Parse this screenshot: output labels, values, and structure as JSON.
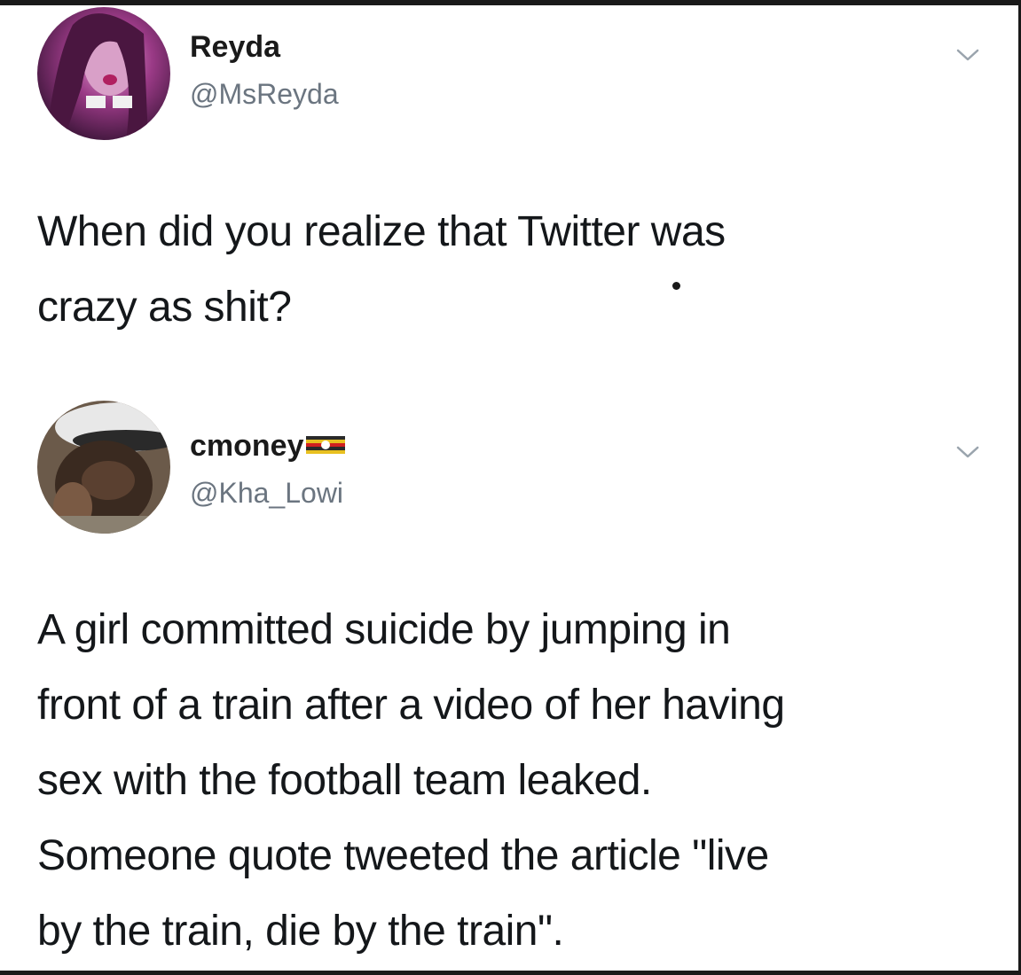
{
  "tweets": [
    {
      "display_name": "Reyda",
      "handle": "@MsReyda",
      "text_lines": [
        "When did you realize that Twitter was",
        "crazy as shit?"
      ]
    },
    {
      "display_name": "cmoney",
      "handle": "@Kha_Lowi",
      "name_badge": "flag-icon",
      "text_lines": [
        "A girl committed suicide by jumping in",
        "front of a train after a video of her having",
        "sex with the football team leaked.",
        "Someone quote tweeted the article \"live",
        "by the train, die by the train\"."
      ]
    }
  ],
  "icons": {
    "menu": "chevron-down-icon",
    "avatar": "avatar"
  },
  "colors": {
    "text": "#14171a",
    "handle": "#6b7580",
    "chevron": "#9aa4ad",
    "background": "#ffffff"
  }
}
